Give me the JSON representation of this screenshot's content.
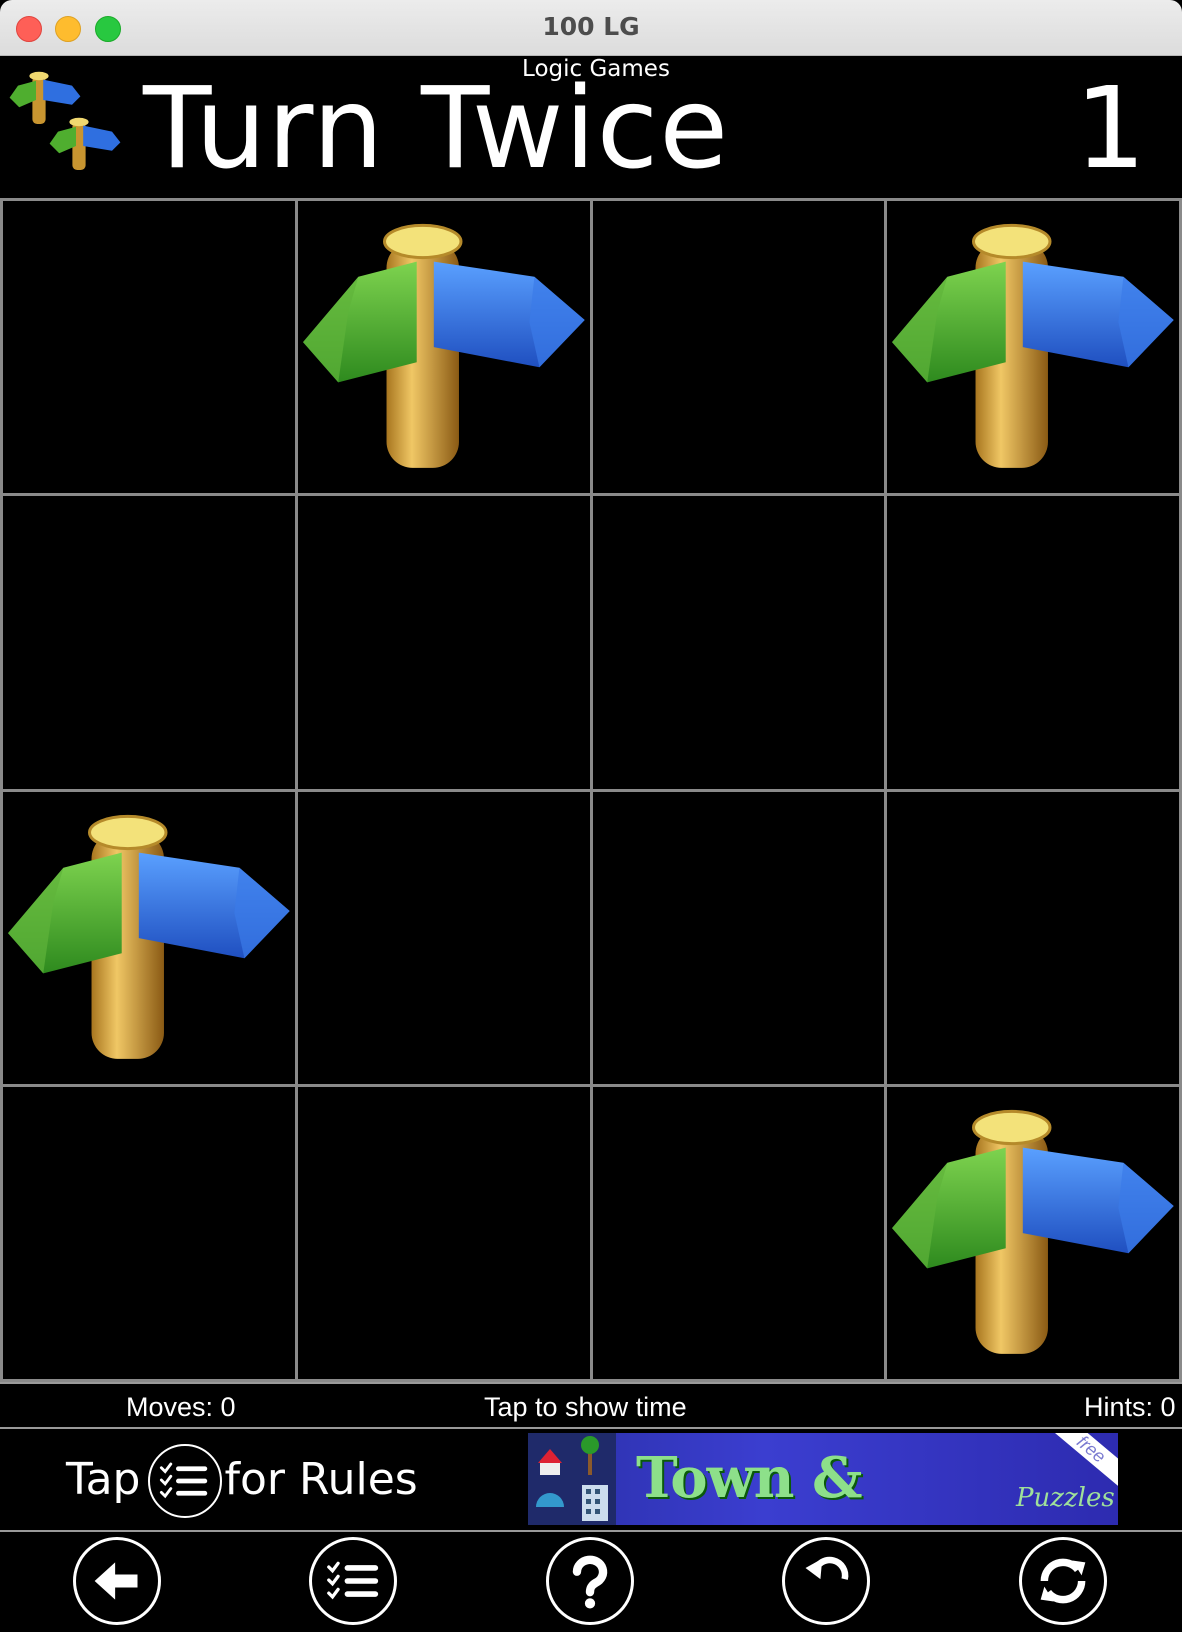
{
  "window": {
    "title": "100 LG"
  },
  "header": {
    "subtitle": "Logic Games",
    "title": "Turn Twice",
    "level": "1"
  },
  "board": {
    "rows": 4,
    "cols": 4,
    "signposts": [
      [
        0,
        1
      ],
      [
        0,
        3
      ],
      [
        2,
        0
      ],
      [
        3,
        3
      ]
    ],
    "icon": "signpost-icon"
  },
  "status": {
    "moves": "Moves: 0",
    "timer": "Tap to show time",
    "hints": "Hints: 0"
  },
  "rules": {
    "tap": "Tap",
    "suffix": "for Rules"
  },
  "ad": {
    "title": "Town & Country",
    "subtitle": "Puzzles",
    "badge": "free"
  },
  "toolbar": {
    "buttons": [
      "back-arrow-icon",
      "rules-list-icon",
      "help-icon",
      "undo-icon",
      "restart-icon"
    ]
  },
  "colors": {
    "grid_line": "#8a8a8a",
    "background": "#000000",
    "arrow_blue": "#2f6fe0",
    "arrow_green": "#4fae2f",
    "post": "#d9a43a"
  }
}
